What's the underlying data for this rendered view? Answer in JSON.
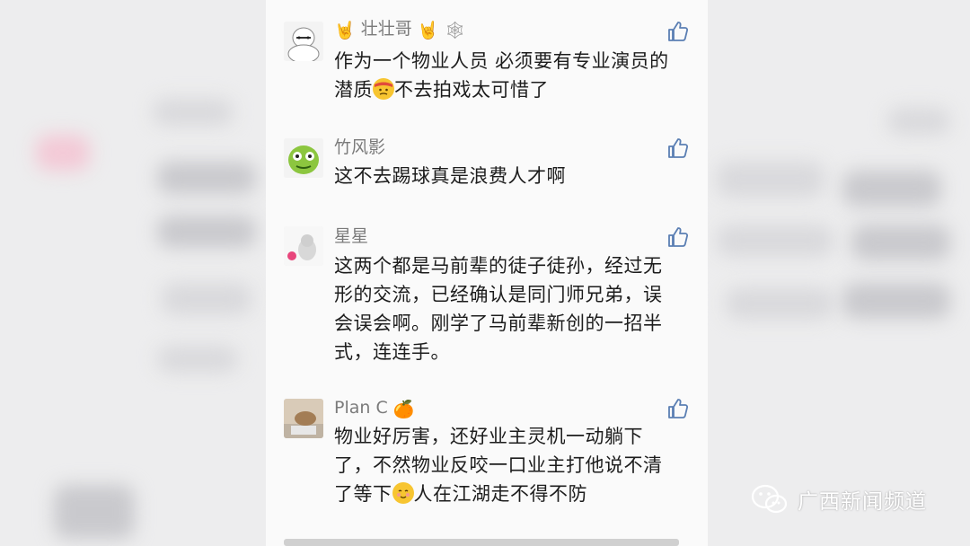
{
  "comments": [
    {
      "user": "壮壮哥",
      "text": "作为一个物业人员 必须要有专业演员的\n潜质",
      "text_tail": "不去拍戏太可惜了"
    },
    {
      "user": "竹风影",
      "text": "这不去踢球真是浪费人才啊"
    },
    {
      "user": "星星",
      "text": "这两个都是马前辈的徒子徒孙，经过无\n形的交流，已经确认是同门师兄弟，误\n会误会啊。刚学了马前辈新创的一招半\n式，连连手。"
    },
    {
      "user": "Plan C",
      "text": "物业好厉害，还好业主灵机一动躺下\n了，不然物业反咬一口业主打他说不清\n了等下",
      "text_tail": "人在江湖走不得不防"
    }
  ],
  "watermark": "广西新闻频道",
  "colors": {
    "thumb": "#5b7fb3",
    "name": "#7b7b7b",
    "text": "#1d1d1d"
  }
}
